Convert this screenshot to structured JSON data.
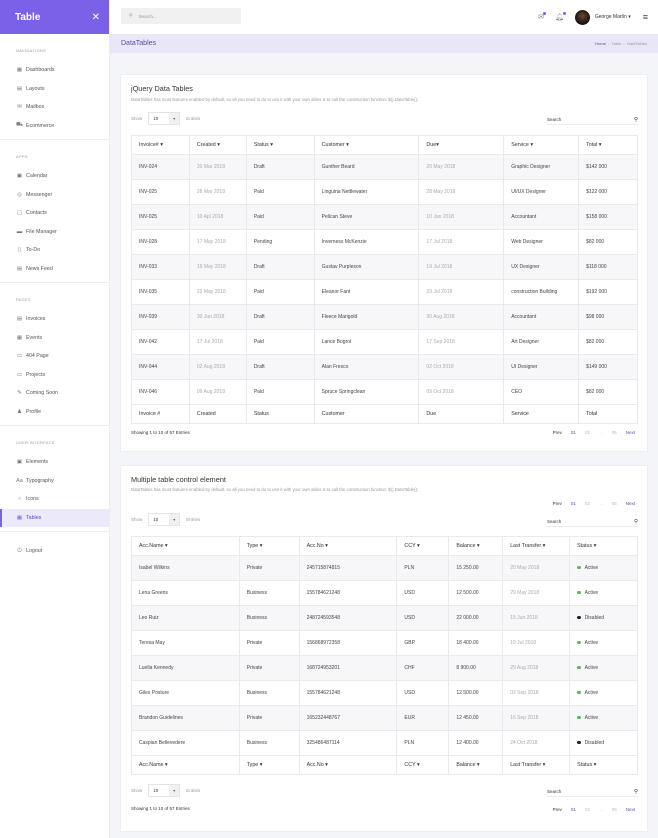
{
  "brand": {
    "title": "Table",
    "icon": "tools-icon"
  },
  "sidebar": {
    "sections": [
      {
        "heading": "Navigations",
        "items": [
          {
            "label": "Dashboards",
            "icon": "dashboard-icon"
          },
          {
            "label": "Layouts",
            "icon": "layout-icon"
          },
          {
            "label": "Mailbox",
            "icon": "mail-icon"
          },
          {
            "label": "Ecommerce",
            "icon": "cart-icon"
          }
        ]
      },
      {
        "heading": "Apps",
        "items": [
          {
            "label": "Calendar",
            "icon": "calendar-icon"
          },
          {
            "label": "Messenger",
            "icon": "chat-icon"
          },
          {
            "label": "Contacts",
            "icon": "contacts-icon"
          },
          {
            "label": "File Manager",
            "icon": "folder-icon"
          },
          {
            "label": "To-Do",
            "icon": "todo-icon"
          },
          {
            "label": "News Feed",
            "icon": "news-icon"
          }
        ]
      },
      {
        "heading": "Pages",
        "items": [
          {
            "label": "Invoices",
            "icon": "invoice-icon"
          },
          {
            "label": "Events",
            "icon": "events-icon"
          },
          {
            "label": "404 Page",
            "icon": "monitor-icon"
          },
          {
            "label": "Projects",
            "icon": "projects-icon"
          },
          {
            "label": "Coming Soon",
            "icon": "edit-icon"
          },
          {
            "label": "Profile",
            "icon": "user-icon"
          }
        ]
      },
      {
        "heading": "User Interface",
        "items": [
          {
            "label": "Elements",
            "icon": "elements-icon"
          },
          {
            "label": "Typography",
            "icon": "typography-icon"
          },
          {
            "label": "Icons",
            "icon": "icons-icon"
          },
          {
            "label": "Tables",
            "icon": "table-icon",
            "active": true
          }
        ]
      }
    ],
    "logout": {
      "label": "Logout",
      "icon": "power-icon"
    }
  },
  "topbar": {
    "search_placeholder": "Search...",
    "user_name": "George Martin",
    "accent": "#7b61e8"
  },
  "page_header": {
    "title": "DataTables",
    "breadcrumb": [
      "Home",
      "Table",
      "DataTables"
    ]
  },
  "card1": {
    "title": "jQuery Data Tables",
    "description": "DataTables has most features enabled by default, so all you need to do to use it with your own ables is to call the construction function: $().DataTable();.",
    "show_label": "Show",
    "entries_value": "10",
    "entries_label": "Entries",
    "search_label": "Search",
    "columns": [
      "Invoice# ▾",
      "Created ▾",
      "Status ▾",
      "Customer ▾",
      "Due▾",
      "Service ▾",
      "Total ▾"
    ],
    "footer_columns": [
      "Invoice #",
      "Created",
      "Status",
      "Customer",
      "Due",
      "Service",
      "Total"
    ],
    "rows": [
      [
        "INV-024",
        "20 Mar 2018",
        "Draft",
        "Gunther Beard",
        "20 May 2018",
        "Graphic Designer",
        "$142 000"
      ],
      [
        "INV-025",
        "28 Mar 2018",
        "Paid",
        "Linguina Nettlewater",
        "28 May 2018",
        "UI/UX Designer",
        "$122 000"
      ],
      [
        "INV-025",
        "10 Apl 2018",
        "Paid",
        "Pelican Steve",
        "10 Jun 2018",
        "Accountant",
        "$158 000"
      ],
      [
        "INV-028",
        "17 May 2018",
        "Pending",
        "Inverness McKenzie",
        "17 Jul 2018",
        "Web Designer",
        "$82 000"
      ],
      [
        "INV-033",
        "19 May 2018",
        "Draft",
        "Gustav Purpleson",
        "19 Jul 2018",
        "UX Designer",
        "$118 000"
      ],
      [
        "INV-035",
        "23 May 2018",
        "Paid",
        "Eleanor Fant",
        "23 Jul 2018",
        "construction Building",
        "$192 000"
      ],
      [
        "INV-039",
        "30 Jun 2018",
        "Draft",
        "Fleece Marigold",
        "30 Aug 2018",
        "Accountant",
        "$98 000"
      ],
      [
        "INV-042",
        "17 Jul 2018",
        "Paid",
        "Lance Bogrol",
        "17 Sep 2018",
        "Art Designer",
        "$82 000"
      ],
      [
        "INV-044",
        "02 Aug 2018",
        "Draft",
        "Alan Fresco",
        "02 Oct 2018",
        "UI Designer",
        "$149 000"
      ],
      [
        "INV-046",
        "09 Aug 2018",
        "Paid",
        "Spruce Springclean",
        "09 Oct 2018",
        "CEO",
        "$82 000"
      ]
    ],
    "showing": "Showing 1 to 10 of 57 Entries",
    "pager": {
      "prev": "Prev",
      "pages": [
        "01",
        "02",
        "...",
        "05"
      ],
      "current": "01",
      "next": "Next"
    }
  },
  "card2": {
    "title": "Multiple table control element",
    "description": "DataTables has most features enabled by default, so all you need to do to use it with your own ables is to call the construction function: $().DataTable();.",
    "show_label": "Show",
    "entries_value": "10",
    "entries_label": "Entries",
    "search_label": "Search",
    "columns": [
      "Acc.Name ▾",
      "Type ▾",
      "Acc.No ▾",
      "CCY ▾",
      "Balance ▾",
      "Last Transfer ▾",
      "Status ▾"
    ],
    "rows": [
      [
        "Isabel Wilkins",
        "Private",
        "245715874815",
        "PLN",
        "15 250.00",
        "20 May 2018",
        "Active"
      ],
      [
        "Lena Greens",
        "Business",
        "155784621248",
        "USD",
        "12 500.00",
        "29 May 2018",
        "Active"
      ],
      [
        "Leo Ruiz",
        "Business",
        "248724593548",
        "USD",
        "22 000.00",
        "15 Jun 2018",
        "Disabled"
      ],
      [
        "Teresa May",
        "Private",
        "156868972358",
        "GBP",
        "18 400.00",
        "19 Jul 2018",
        "Active"
      ],
      [
        "Luella Kennedy",
        "Private",
        "168724953201",
        "CHF",
        "8 900.00",
        "29 Aug 2018",
        "Active"
      ],
      [
        "Giles Posture",
        "Business",
        "155784621248",
        "USD",
        "12 500.00",
        "02 Sep 2018",
        "Active"
      ],
      [
        "Brandon Guidelines",
        "Private",
        "165232448767",
        "EUR",
        "12 450.00",
        "16 Sep 2018",
        "Active"
      ],
      [
        "Caspian Bellevedere",
        "Business",
        "325486487114",
        "PLN",
        "12 400.00",
        "24 Oct 2018",
        "Disabled"
      ]
    ],
    "status_colors": {
      "Active": "#5cb85c",
      "Disabled": "#222222"
    },
    "showing": "Showing 1 to 10 of 57 Entries",
    "pager": {
      "prev": "Prev",
      "pages": [
        "01",
        "02",
        "...",
        "05"
      ],
      "current": "01",
      "next": "Next"
    }
  }
}
